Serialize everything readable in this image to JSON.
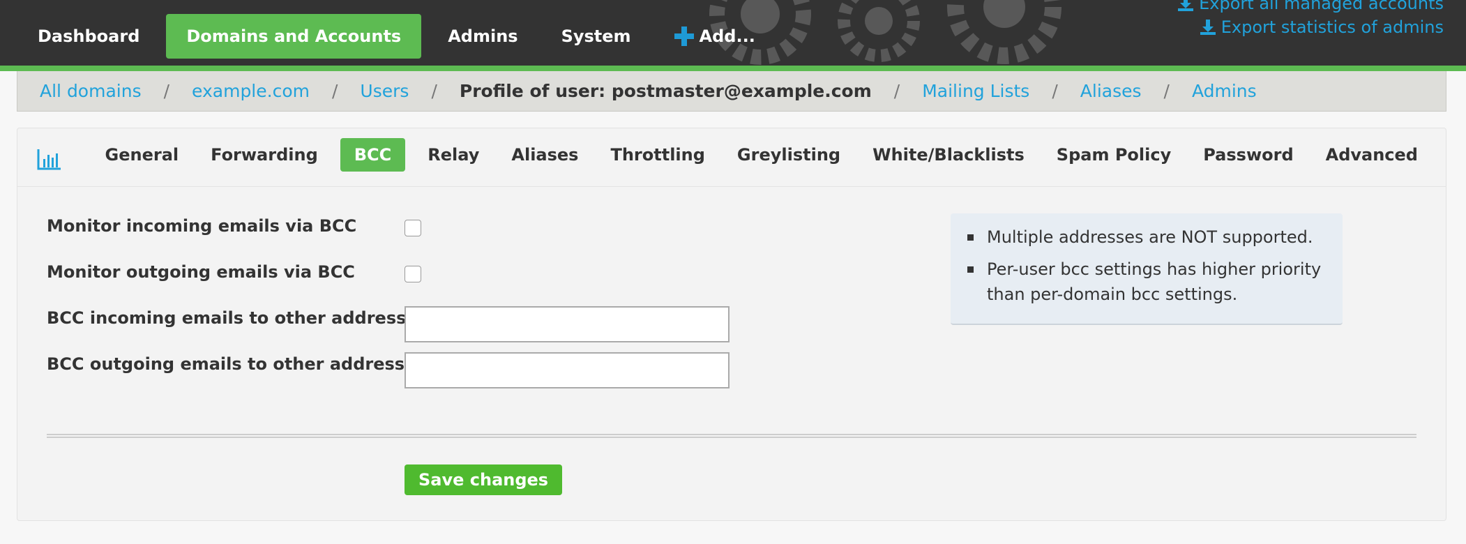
{
  "nav": {
    "items": [
      {
        "label": "Dashboard"
      },
      {
        "label": "Domains and Accounts",
        "active": true
      },
      {
        "label": "Admins"
      },
      {
        "label": "System"
      },
      {
        "label": "Add...",
        "icon": "plus-icon"
      }
    ]
  },
  "exports": {
    "all_accounts": "Export all managed accounts",
    "admin_stats": "Export statistics of admins",
    "icon": "download-icon"
  },
  "breadcrumb": {
    "all_domains": "All domains",
    "domain": "example.com",
    "users": "Users",
    "current": "Profile of user: postmaster@example.com",
    "mailing_lists": "Mailing Lists",
    "aliases": "Aliases",
    "admins": "Admins",
    "separator": "/"
  },
  "tabs": [
    "General",
    "Forwarding",
    "BCC",
    "Relay",
    "Aliases",
    "Throttling",
    "Greylisting",
    "White/Blacklists",
    "Spam Policy",
    "Password",
    "Advanced"
  ],
  "active_tab": "BCC",
  "form": {
    "monitor_incoming_label": "Monitor incoming emails via BCC",
    "monitor_outgoing_label": "Monitor outgoing emails via BCC",
    "bcc_incoming_label": "BCC incoming emails to other address",
    "bcc_outgoing_label": "BCC outgoing emails to other address",
    "bcc_incoming_value": "",
    "bcc_outgoing_value": "",
    "monitor_incoming_checked": false,
    "monitor_outgoing_checked": false
  },
  "notice": {
    "items": [
      "Multiple addresses are NOT supported.",
      "Per-user bcc settings has higher priority than per-domain bcc settings."
    ]
  },
  "save_label": "Save changes",
  "colors": {
    "header_bg": "#333333",
    "accent_green": "#5dbb52",
    "link_blue": "#21a2db",
    "notice_bg": "#e7edf3"
  }
}
